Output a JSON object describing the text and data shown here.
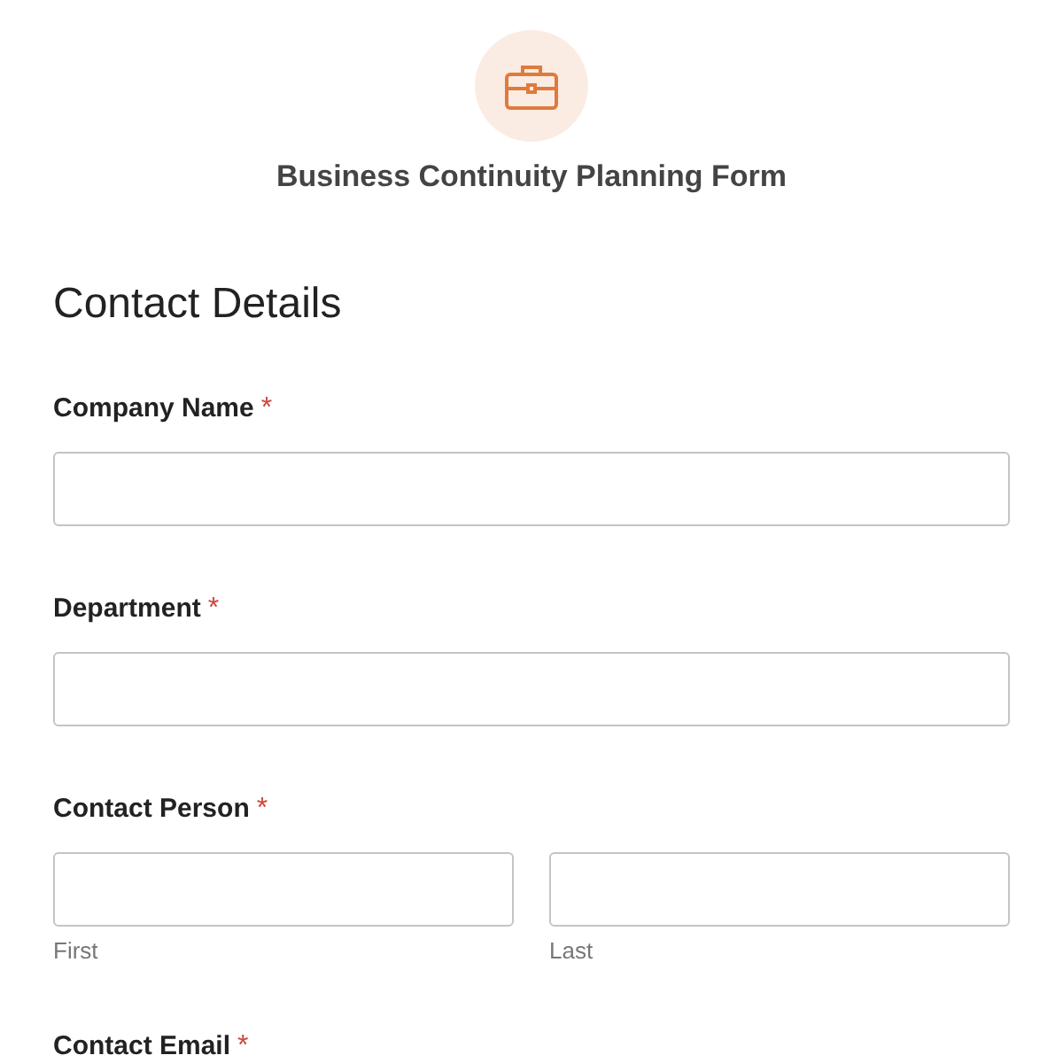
{
  "form_title": "Business Continuity Planning Form",
  "section_title": "Contact Details",
  "fields": [
    {
      "kind": "text",
      "label": "Company Name",
      "required_mark": "*"
    },
    {
      "kind": "text",
      "label": "Department",
      "required_mark": "*"
    },
    {
      "kind": "name",
      "label": "Contact Person",
      "required_mark": "*",
      "sublabels": [
        "First",
        "Last"
      ]
    },
    {
      "kind": "label",
      "label": "Contact Email",
      "required_mark": "*"
    }
  ]
}
